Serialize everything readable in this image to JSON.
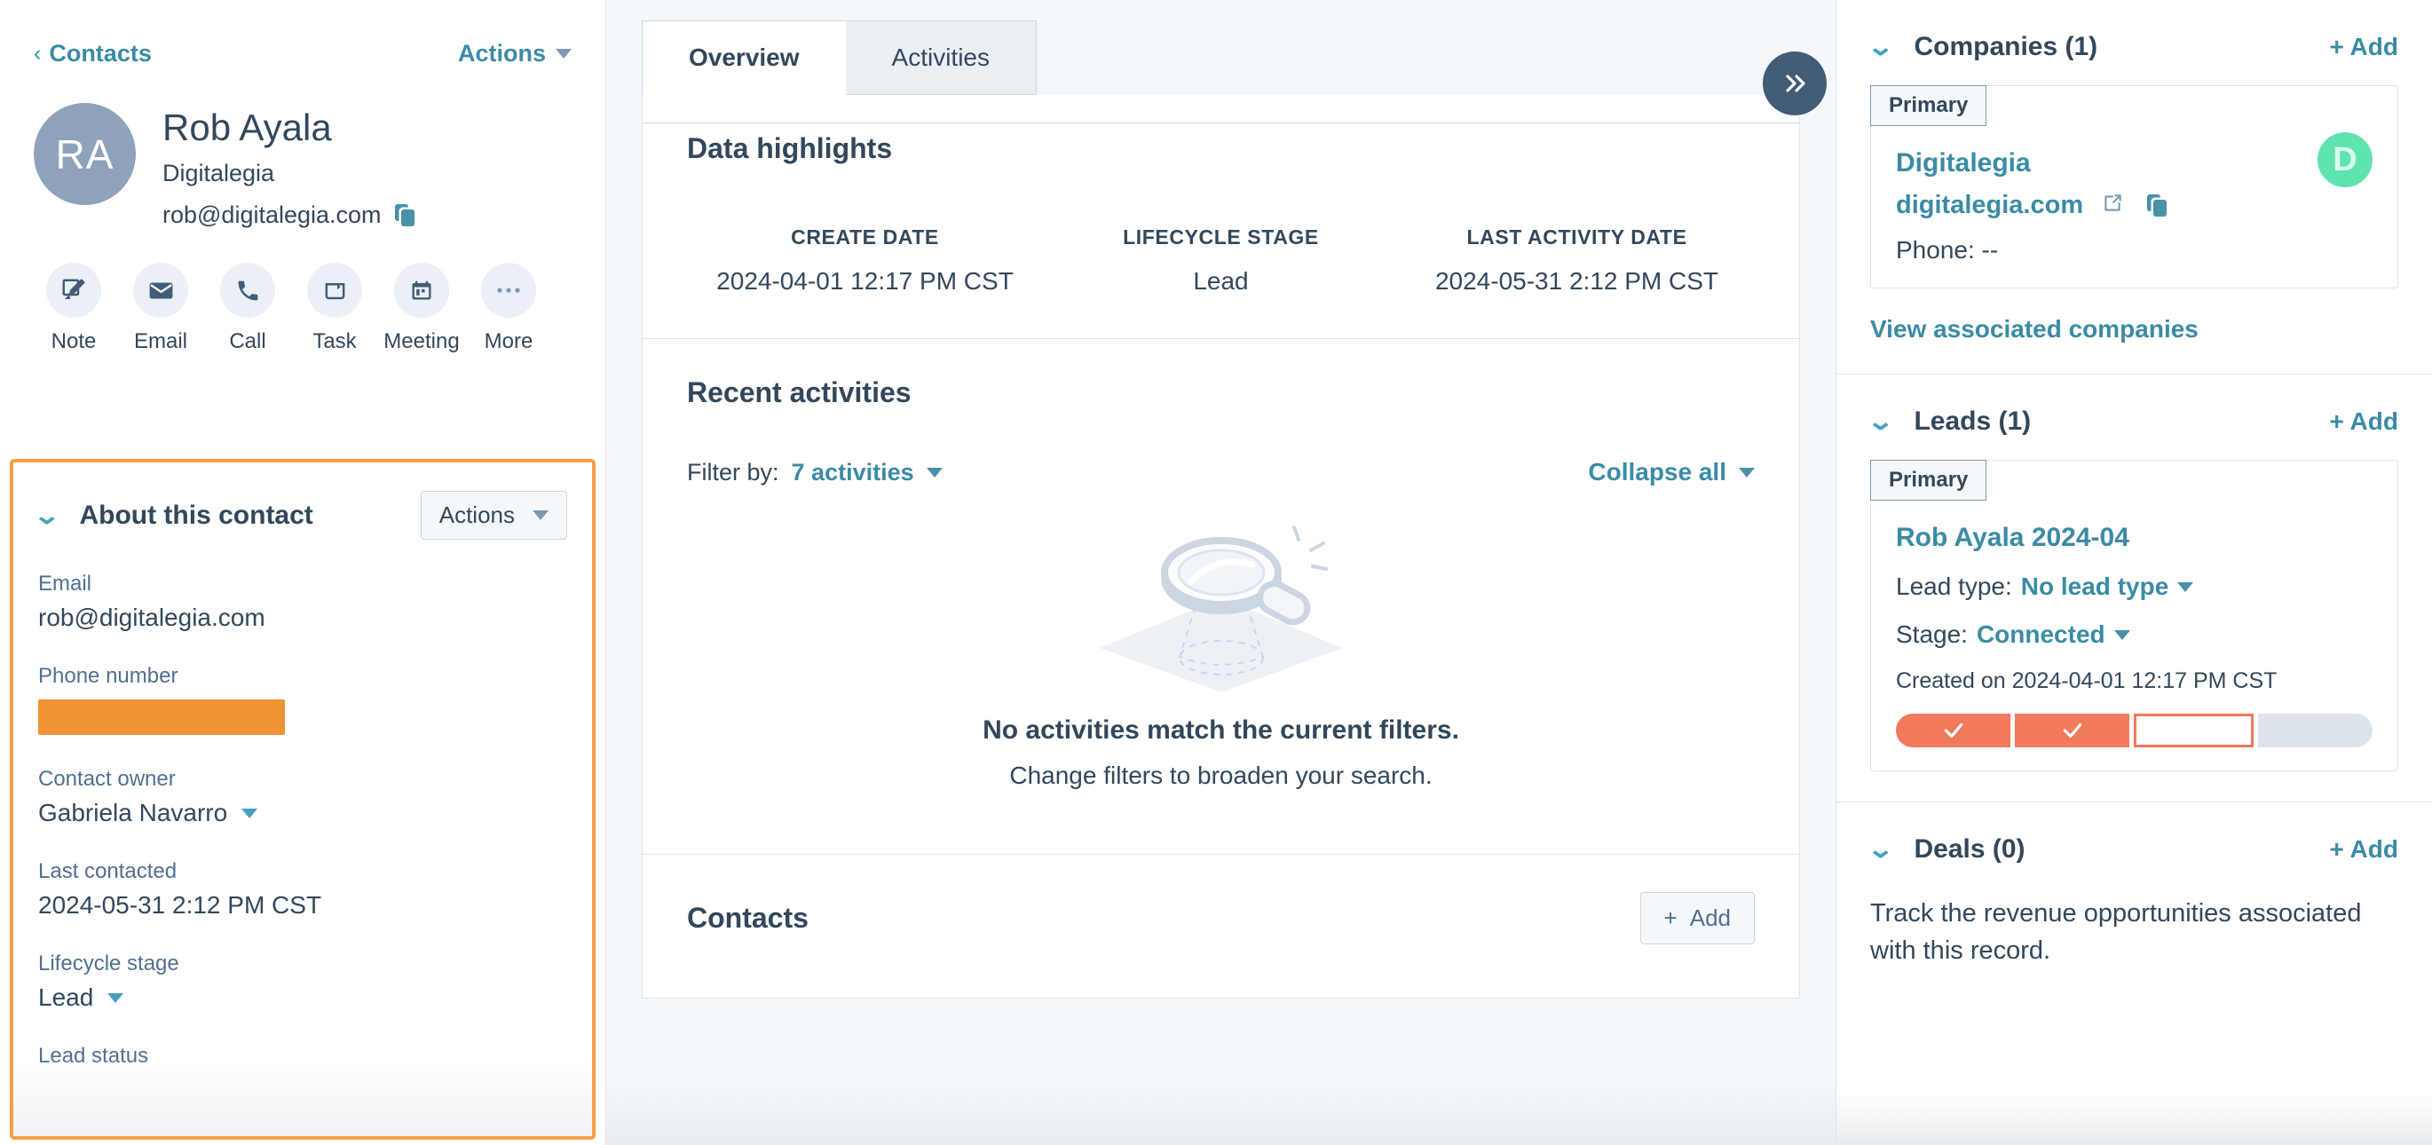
{
  "left_sidebar": {
    "back_label": "Contacts",
    "back_icon": "chevron-left-icon",
    "actions_label": "Actions",
    "contact": {
      "initials": "RA",
      "name": "Rob Ayala",
      "company": "Digitalegia",
      "email": "rob@digitalegia.com",
      "copy_icon": "copy-icon"
    },
    "quick_actions": [
      {
        "label": "Note",
        "icon": "note-edit-icon"
      },
      {
        "label": "Email",
        "icon": "envelope-icon"
      },
      {
        "label": "Call",
        "icon": "phone-icon"
      },
      {
        "label": "Task",
        "icon": "task-card-icon"
      },
      {
        "label": "Meeting",
        "icon": "calendar-icon"
      },
      {
        "label": "More",
        "icon": "ellipsis-icon"
      }
    ],
    "about": {
      "title": "About this contact",
      "toggle_icon": "chevron-down-icon",
      "actions_label": "Actions",
      "highlight_color": "#f5a142",
      "fields": [
        {
          "label": "Email",
          "value": "rob@digitalegia.com",
          "type": "text"
        },
        {
          "label": "Phone number",
          "value": "",
          "type": "redacted"
        },
        {
          "label": "Contact owner",
          "value": "Gabriela Navarro",
          "type": "dropdown"
        },
        {
          "label": "Last contacted",
          "value": "2024-05-31 2:12 PM CST",
          "type": "text"
        },
        {
          "label": "Lifecycle stage",
          "value": "Lead",
          "type": "dropdown"
        },
        {
          "label": "Lead status",
          "value": "",
          "type": "text"
        }
      ]
    }
  },
  "center": {
    "tabs": [
      {
        "label": "Overview",
        "active": true
      },
      {
        "label": "Activities",
        "active": false
      }
    ],
    "collapse_fab_icon": "double-chevron-right-icon",
    "data_highlights": {
      "title": "Data highlights",
      "items": [
        {
          "key": "CREATE DATE",
          "value": "2024-04-01 12:17 PM CST"
        },
        {
          "key": "LIFECYCLE STAGE",
          "value": "Lead"
        },
        {
          "key": "LAST ACTIVITY DATE",
          "value": "2024-05-31 2:12 PM CST"
        }
      ]
    },
    "recent_activities": {
      "title": "Recent activities",
      "filter_prefix": "Filter by:",
      "filter_value": "7 activities",
      "collapse_all": "Collapse all",
      "empty_illustration": "magnifying-glass-search-icon",
      "empty_heading": "No activities match the current filters.",
      "empty_sub": "Change filters to broaden your search."
    },
    "contacts_section": {
      "title": "Contacts",
      "add_label": "Add",
      "add_icon": "plus-icon"
    }
  },
  "right_sidebar": {
    "companies": {
      "title": "Companies (1)",
      "add_label": "+ Add",
      "toggle_icon": "chevron-down-icon",
      "badge": "Primary",
      "name": "Digitalegia",
      "domain": "digitalegia.com",
      "external_icon": "external-link-icon",
      "copy_icon": "copy-icon",
      "phone": "Phone: --",
      "logo_letter": "D",
      "logo_color": "#5fe3af",
      "view_link": "View associated companies"
    },
    "leads": {
      "title": "Leads (1)",
      "add_label": "+ Add",
      "toggle_icon": "chevron-down-icon",
      "badge": "Primary",
      "name": "Rob Ayala 2024-04",
      "lead_type_label": "Lead type:",
      "lead_type_value": "No lead type",
      "stage_label": "Stage:",
      "stage_value": "Connected",
      "created_on": "Created on 2024-04-01 12:17 PM CST",
      "progress": [
        {
          "state": "done",
          "icon": "check-icon"
        },
        {
          "state": "done",
          "icon": "check-icon"
        },
        {
          "state": "current",
          "icon": ""
        },
        {
          "state": "todo",
          "icon": ""
        }
      ],
      "progress_color": "#f1795c"
    },
    "deals": {
      "title": "Deals (0)",
      "add_label": "+ Add",
      "toggle_icon": "chevron-down-icon",
      "description": "Track the revenue opportunities associated with this record."
    }
  }
}
